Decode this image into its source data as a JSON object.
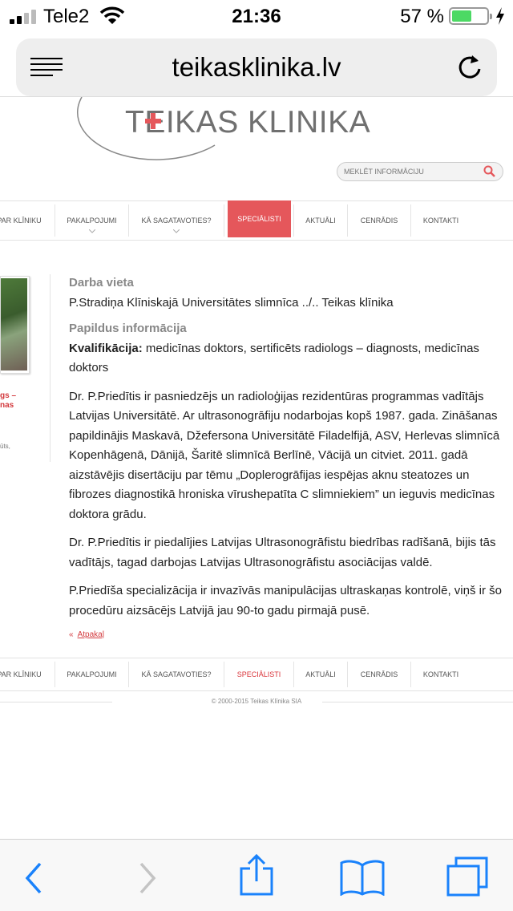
{
  "status": {
    "carrier": "Tele2",
    "time": "21:36",
    "battery": "57 %",
    "battery_level": 0.57
  },
  "browser": {
    "url": "teikasklinika.lv"
  },
  "site": {
    "logo": "TEIKAS KLINIKA",
    "search_placeholder": "MEKLĒT INFORMĀCIJU"
  },
  "nav_top": [
    {
      "label": "PAR KLĪNIKU",
      "has_sub": false,
      "active": false
    },
    {
      "label": "PAKALPOJUMI",
      "has_sub": true,
      "active": false
    },
    {
      "label": "KĀ SAGATAVOTIES?",
      "has_sub": true,
      "active": false
    },
    {
      "label": "SPECIĀLISTI",
      "has_sub": false,
      "active": true
    },
    {
      "label": "AKTUĀLI",
      "has_sub": false,
      "active": false
    },
    {
      "label": "CENRĀDIS",
      "has_sub": false,
      "active": false
    },
    {
      "label": "KONTAKTI",
      "has_sub": false,
      "active": false
    }
  ],
  "sidebar": {
    "name": "gs –\nnas",
    "extra": "ūts,"
  },
  "content": {
    "workplace_heading": "Darba vieta",
    "workplace": "P.Stradiņa Klīniskajā Universitātes slimnīca ../.. Teikas klīnika",
    "info_heading": "Papildus informācija",
    "qualification_label": "Kvalifikācija:",
    "qualification": " medicīnas doktors, sertificēts radiologs – diagnosts, medicīnas doktors",
    "p1": "Dr. P.Priedītis ir pasniedzējs un radioloģijas rezidentūras programmas vadītājs Latvijas Universitātē. Ar ultrasonogrāfiju nodarbojas kopš 1987. gada. Zināšanas papildinājis Maskavā, Džefersona Universitātē Filadelfijā, ASV, Herlevas slimnīcā Kopenhāgenā, Dānijā, Šaritē slimnīcā Berlīnē, Vācijā un citviet. 2011. gadā aizstāvējis disertāciju par tēmu „Doplerogrāfijas iespējas aknu steatozes un fibrozes diagnostikā hroniska vīrushepatīta C slimniekiem” un ieguvis medicīnas doktora grādu.",
    "p2": "Dr. P.Priedītis ir piedalījies Latvijas Ultrasonogrāfistu biedrības radīšanā, bijis tās vadītājs, tagad darbojas Latvijas Ultrasonogrāfistu asociācijas valdē.",
    "p3": "P.Priedīša specializācija ir invazīvās manipulācijas ultraskaņas kontrolē, viņš ir šo procedūru aizsācējs Latvijā jau 90-to gadu pirmajā pusē.",
    "back_prefix": "«",
    "back": "Atpakaļ"
  },
  "nav_bottom": [
    {
      "label": "PAR KLĪNIKU",
      "active": false
    },
    {
      "label": "PAKALPOJUMI",
      "active": false
    },
    {
      "label": "KĀ SAGATAVOTIES?",
      "active": false
    },
    {
      "label": "SPECIĀLISTI",
      "active": true
    },
    {
      "label": "AKTUĀLI",
      "active": false
    },
    {
      "label": "CENRĀDIS",
      "active": false
    },
    {
      "label": "KONTAKTI",
      "active": false
    }
  ],
  "footer": {
    "copyright": "© 2000-2015 Teikas Klīnika SIA"
  },
  "colors": {
    "accent": "#e5575b",
    "link_red": "#d33a3e",
    "ios_blue": "#1a82fb"
  }
}
